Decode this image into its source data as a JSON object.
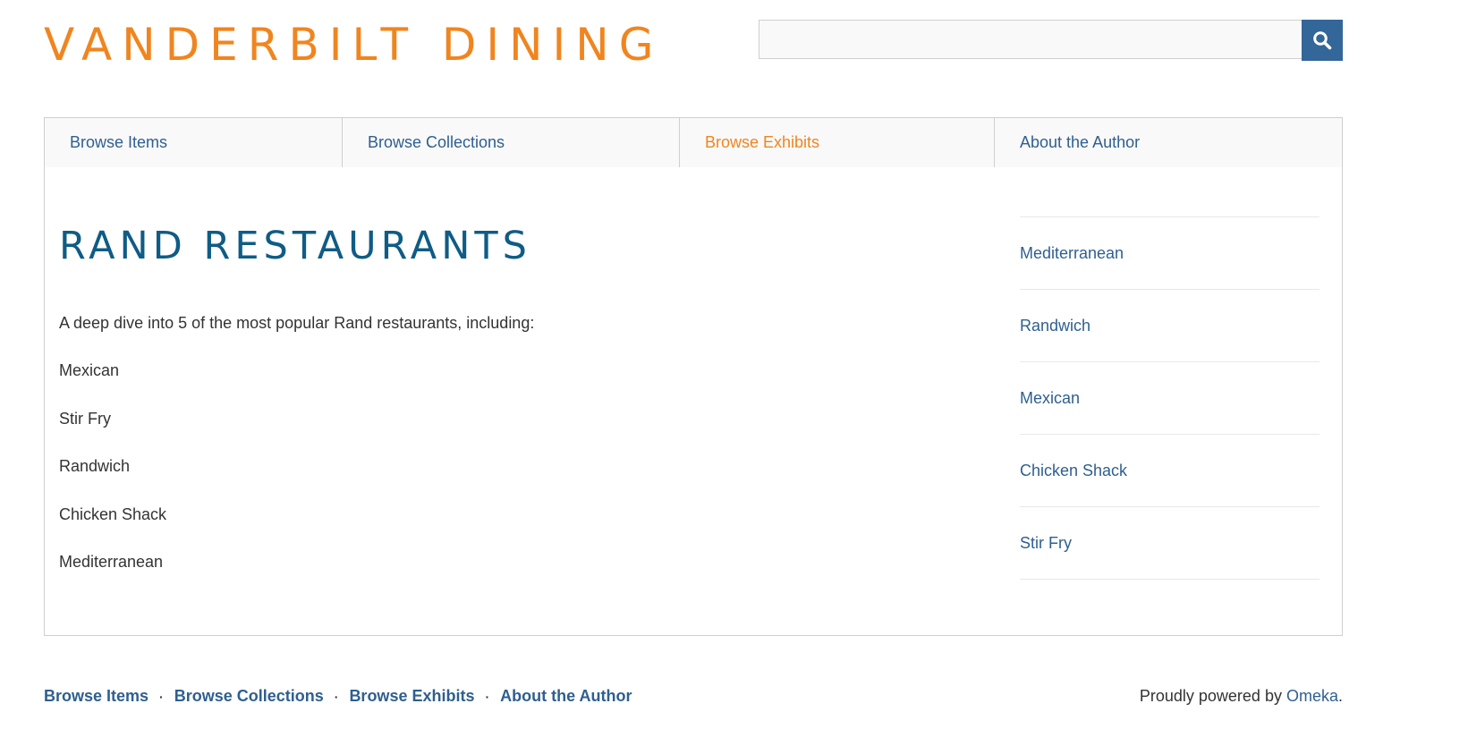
{
  "header": {
    "site_title": "VANDERBILT DINING",
    "search_value": "",
    "search_icon": "search-icon"
  },
  "nav": {
    "items": [
      {
        "label": "Browse Items",
        "active": false
      },
      {
        "label": "Browse Collections",
        "active": false
      },
      {
        "label": "Browse Exhibits",
        "active": true
      },
      {
        "label": "About the Author",
        "active": false
      }
    ]
  },
  "main": {
    "title": "RAND RESTAURANTS",
    "intro": "A deep dive into 5 of the most popular Rand restaurants, including:",
    "list": [
      "Mexican",
      "Stir Fry",
      "Randwich",
      "Chicken Shack",
      "Mediterranean"
    ]
  },
  "sidebar": {
    "pages": [
      "Mediterranean",
      "Randwich",
      "Mexican",
      "Chicken Shack",
      "Stir Fry"
    ]
  },
  "footer": {
    "nav": [
      "Browse Items",
      "Browse Collections",
      "Browse Exhibits",
      "About the Author"
    ],
    "separator": "·",
    "powered_prefix": "Proudly powered by ",
    "powered_link": "Omeka",
    "powered_suffix": "."
  },
  "colors": {
    "accent": "#f0851f",
    "link": "#2f5f8f",
    "title": "#0f5c85",
    "search_button": "#336699"
  }
}
